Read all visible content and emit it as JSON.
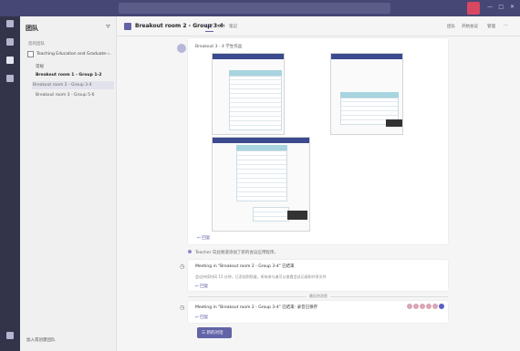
{
  "titlebar": {
    "search_placeholder": "",
    "user_label": "",
    "avatar_color": "#d74860",
    "min": "—",
    "max": "□",
    "close": "✕"
  },
  "rail": [
    {
      "icon": "activity-icon",
      "label": ""
    },
    {
      "icon": "chat-icon",
      "label": ""
    },
    {
      "icon": "teams-icon",
      "label": "",
      "active": true
    },
    {
      "icon": "calls-icon",
      "label": ""
    },
    {
      "icon": "help-icon",
      "label": ""
    }
  ],
  "sidebar": {
    "header": "团队",
    "filter_icon": "filter-icon",
    "section": "您的团队",
    "team_name": "Teaching Education and Graduate ...",
    "team_more": "···",
    "channels": [
      {
        "label": "常规",
        "style": ""
      },
      {
        "label": "Breakout room 1 - Group 1-2",
        "style": "bold"
      },
      {
        "label": "Breakout room 2 - Group 3-4",
        "style": "sel"
      },
      {
        "label": "Breakout room 3 - Group 5-6",
        "style": ""
      }
    ],
    "join_label": "加入或创建团队"
  },
  "channel": {
    "name": "Breakout room 2 - Group 3-4",
    "tabs": [
      "帖子",
      "文件",
      "笔记"
    ],
    "actions": [
      "团队",
      "开始会议",
      "管理",
      "···"
    ]
  },
  "post": {
    "title": "Breakout 3 - 4 学生作品",
    "reply": "↩ 回复"
  },
  "sysline": "Teacher 向此频道添加了新的会议应用程序。",
  "cards": [
    {
      "title": "Meeting in \"Breakout room 2 - Group 3-4\" 已结束",
      "subtitle": "会议持续时间 15 分钟，已添加到频道，所有参与者可以查看会议记录和共享文件",
      "reply": "↩ 回复"
    },
    {
      "title": "Meeting in \"Breakout room 2 - Group 3-4\" 已结束: 录音已保存",
      "subtitle": "",
      "reply": "↩ 回复"
    }
  ],
  "divider": "最近的消息",
  "new_conversation": "☰ 新的对话"
}
